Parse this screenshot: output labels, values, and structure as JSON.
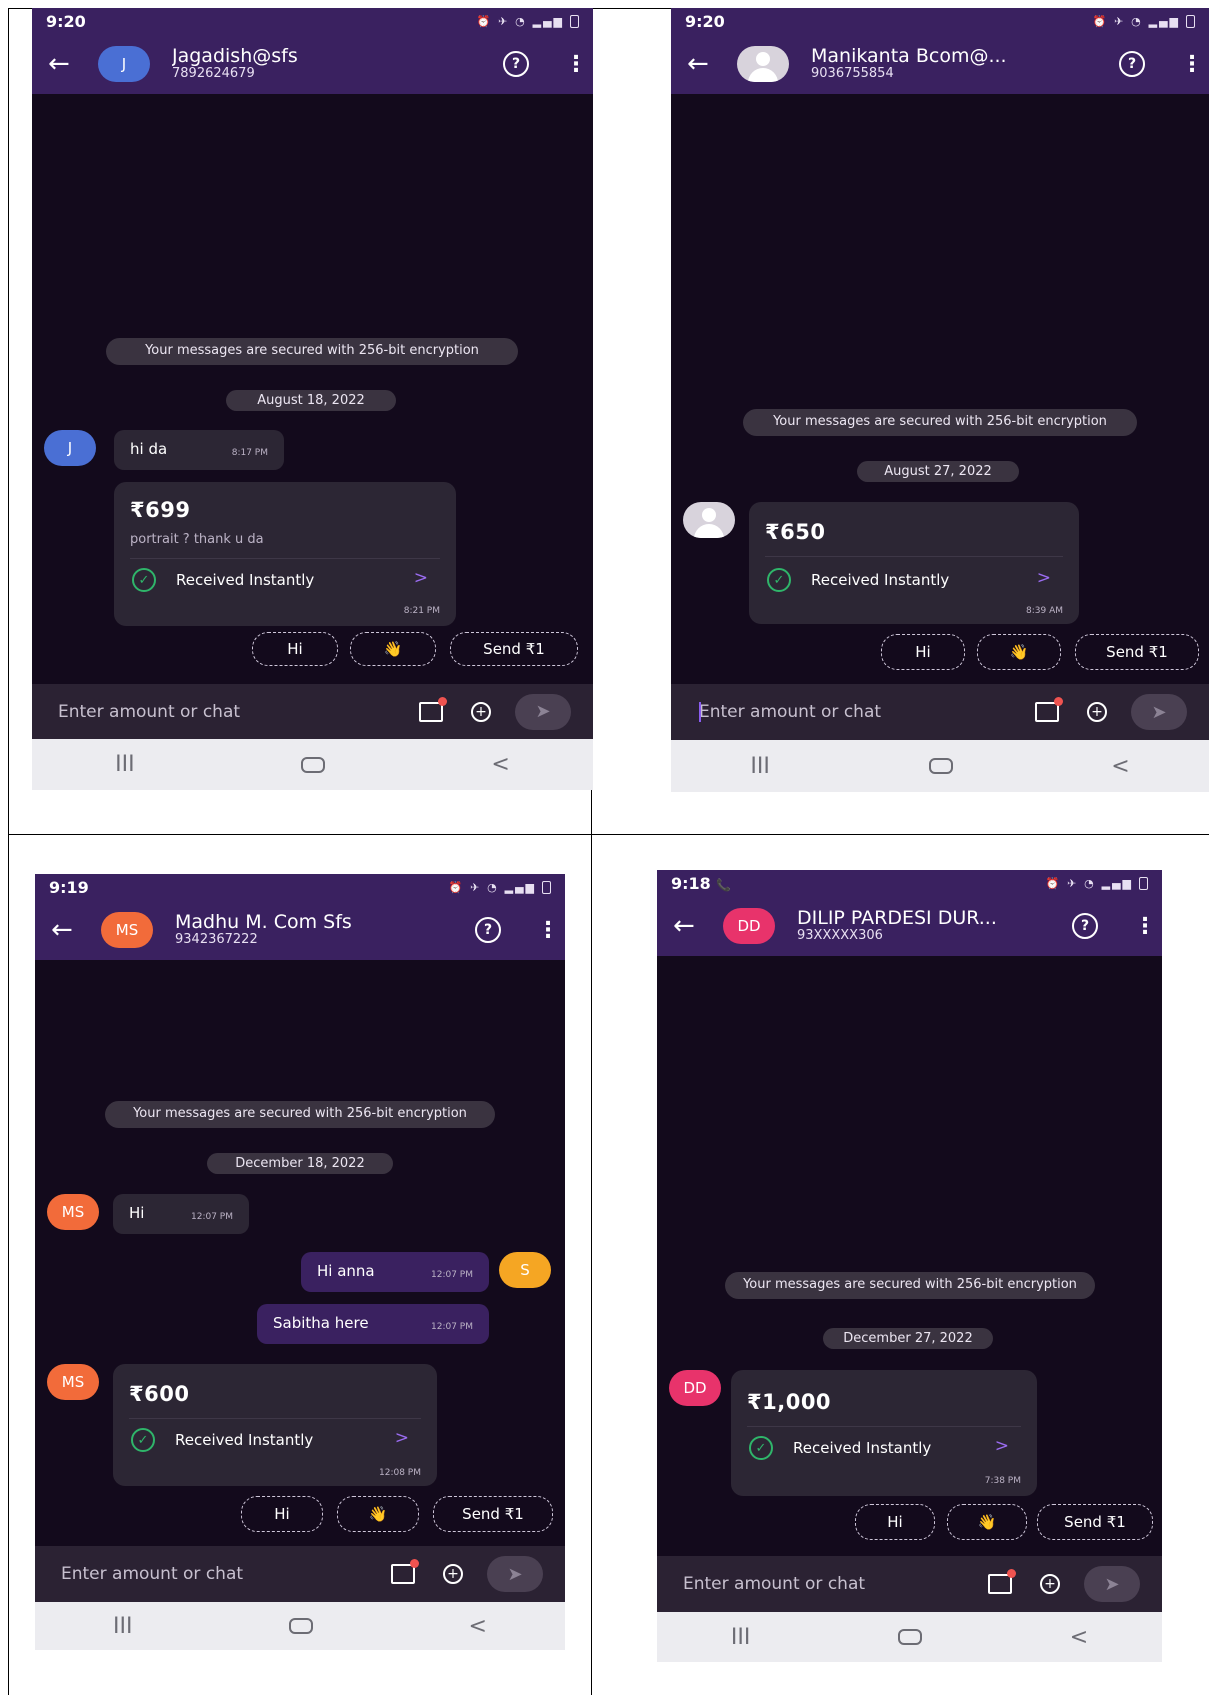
{
  "screens": [
    {
      "status_time": "9:20",
      "contact_name": "Jagadish@sfs",
      "contact_phone": "7892624679",
      "avatar_initials": "J",
      "avatar_color": "#4a6fd4",
      "encryption_notice": "Your messages are secured with 256-bit encryption",
      "date_chip": "August 18, 2022",
      "messages": [
        {
          "text": "hi da",
          "time": "8:17 PM",
          "from": "contact"
        }
      ],
      "payment": {
        "amount": "₹699",
        "note": "portrait ? thank u da",
        "status": "Received Instantly",
        "time": "8:21 PM"
      },
      "quick_replies": [
        "Hi",
        "👋",
        "Send ₹1"
      ],
      "input_placeholder": "Enter amount or chat"
    },
    {
      "status_time": "9:20",
      "contact_name": "Manikanta Bcom@...",
      "contact_phone": "9036755854",
      "avatar_initials": "",
      "avatar_color": "#d8d3dc",
      "encryption_notice": "Your messages are secured with 256-bit encryption",
      "date_chip": "August 27, 2022",
      "messages": [],
      "payment": {
        "amount": "₹650",
        "note": "",
        "status": "Received Instantly",
        "time": "8:39 AM"
      },
      "quick_replies": [
        "Hi",
        "👋",
        "Send ₹1"
      ],
      "input_placeholder": "Enter amount or chat"
    },
    {
      "status_time": "9:19",
      "contact_name": "Madhu M. Com Sfs",
      "contact_phone": "9342367222",
      "avatar_initials": "MS",
      "avatar_color": "#f26b3a",
      "self_initials": "S",
      "self_color": "#f5a623",
      "encryption_notice": "Your messages are secured with 256-bit encryption",
      "date_chip": "December 18, 2022",
      "messages": [
        {
          "text": "Hi",
          "time": "12:07 PM",
          "from": "contact"
        },
        {
          "text": "Hi anna",
          "time": "12:07 PM",
          "from": "self"
        },
        {
          "text": "Sabitha here",
          "time": "12:07 PM",
          "from": "self"
        }
      ],
      "payment": {
        "amount": "₹600",
        "note": "",
        "status": "Received Instantly",
        "time": "12:08 PM"
      },
      "quick_replies": [
        "Hi",
        "👋",
        "Send ₹1"
      ],
      "input_placeholder": "Enter amount or chat"
    },
    {
      "status_time": "9:18",
      "contact_name": "DILIP PARDESI DUR...",
      "contact_phone": "93XXXXX306",
      "avatar_initials": "DD",
      "avatar_color": "#e8336b",
      "encryption_notice": "Your messages are secured with 256-bit encryption",
      "date_chip": "December 27, 2022",
      "messages": [],
      "payment": {
        "amount": "₹1,000",
        "note": "",
        "status": "Received Instantly",
        "time": "7:38 PM"
      },
      "quick_replies": [
        "Hi",
        "👋",
        "Send ₹1"
      ],
      "input_placeholder": "Enter amount or chat"
    }
  ],
  "icons": {
    "back": "arrow-left-icon",
    "help": "question-circle-icon",
    "menu": "kebab-menu-icon",
    "check": "check-circle-icon",
    "chevron": "chevron-right-icon",
    "gallery": "gallery-icon",
    "plus": "plus-circle-icon",
    "send": "send-icon"
  },
  "nav_glyphs": {
    "recents": "III",
    "back": "<"
  },
  "glyphs": {
    "back_arrow": "←",
    "help": "?",
    "kebab": "⋮",
    "check": "✓",
    "chevron": ">",
    "send": "➤",
    "plus": "+",
    "call": "📞"
  }
}
